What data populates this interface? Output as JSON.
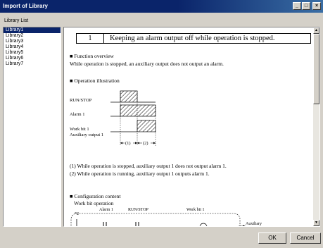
{
  "window": {
    "title": "Import of Library",
    "minimize": "_",
    "maximize": "□",
    "close": "×"
  },
  "library_list": {
    "label": "Library List",
    "items": [
      "Library1",
      "Library2",
      "Library3",
      "Library4",
      "Library5",
      "Library6",
      "Library7"
    ],
    "selected_index": 0
  },
  "doc": {
    "heading_num": "1",
    "heading_text": "Keeping an alarm output off while operation is stopped.",
    "function_overview_title": "■ Function overview",
    "function_overview_text": "While operation is stopped, an auxiliary output does not output an alarm.",
    "operation_illustration_title": "■ Operation illustration",
    "signals": [
      "RUN/STOP",
      "Alarm 1",
      "Work bit 1",
      "Auxiliary output 1"
    ],
    "interval_1": "(1)",
    "interval_2": "(2)",
    "notes": [
      "(1)  While operation is stopped, auxiliary output 1 does not output alarm 1.",
      "(2)  While operation is running, auxiliary output 1 outputs alarm 1."
    ],
    "config_title": "■ Configuration content",
    "config_sub": "Work bit operation",
    "ladder_tag": "*2",
    "ladder_alarm": "Alarm 1",
    "ladder_runstop": "RUN/STOP",
    "ladder_workbit": "Work bit 1",
    "ladder_aux": "Auxiliary"
  },
  "scroll": {
    "up": "▲",
    "down": "▼"
  },
  "buttons": {
    "ok": "OK",
    "cancel": "Cancel"
  }
}
